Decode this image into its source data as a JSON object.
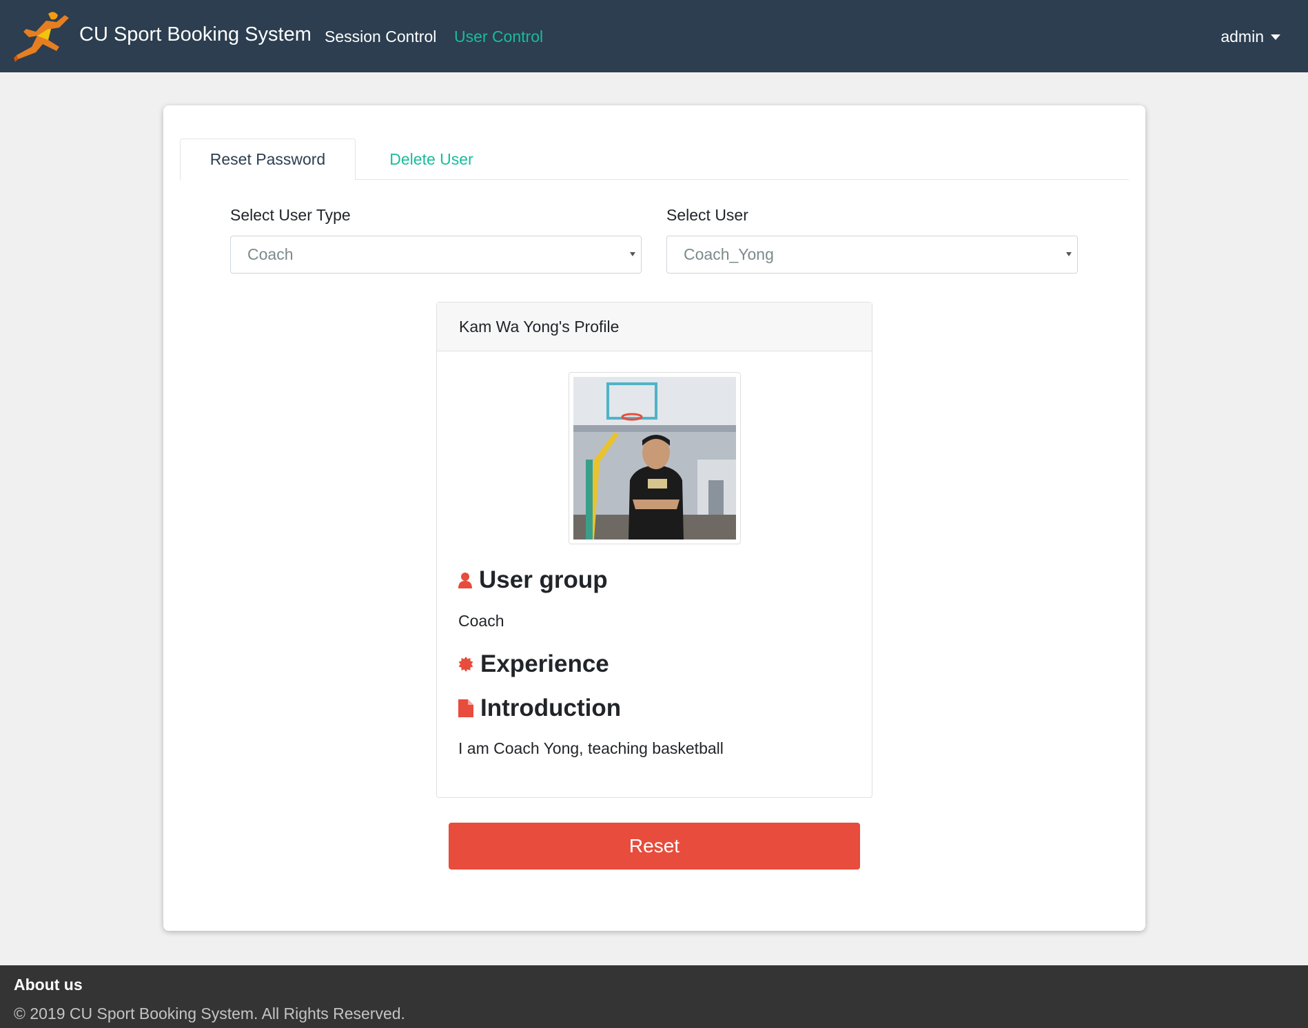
{
  "navbar": {
    "logo_icon": "runner-logo-icon",
    "brand": "CU Sport Booking System",
    "links": [
      {
        "label": "Session Control",
        "active": false
      },
      {
        "label": "User Control",
        "active": true
      }
    ],
    "user_menu": "admin",
    "accent_color": "#18bc9c",
    "background_color": "#2c3e50"
  },
  "tabs": [
    {
      "label": "Reset Password",
      "active": true
    },
    {
      "label": "Delete User",
      "active": false
    }
  ],
  "form": {
    "user_type_label": "Select User Type",
    "user_type_value": "Coach",
    "user_label": "Select User",
    "user_value": "Coach_Yong"
  },
  "profile": {
    "header": "Kam Wa Yong's Profile",
    "photo_icon": "coach-photo",
    "user_group_title": "User group",
    "user_group_icon": "user-icon",
    "user_group_value": "Coach",
    "experience_title": "Experience",
    "experience_icon": "certificate-icon",
    "introduction_title": "Introduction",
    "introduction_icon": "file-icon",
    "introduction_value": "I am Coach Yong, teaching basketball",
    "icon_color": "#e74c3c"
  },
  "actions": {
    "reset_label": "Reset",
    "reset_color": "#e74c3c"
  },
  "footer": {
    "title": "About us",
    "copyright": "© 2019 CU Sport Booking System. All Rights Reserved."
  }
}
